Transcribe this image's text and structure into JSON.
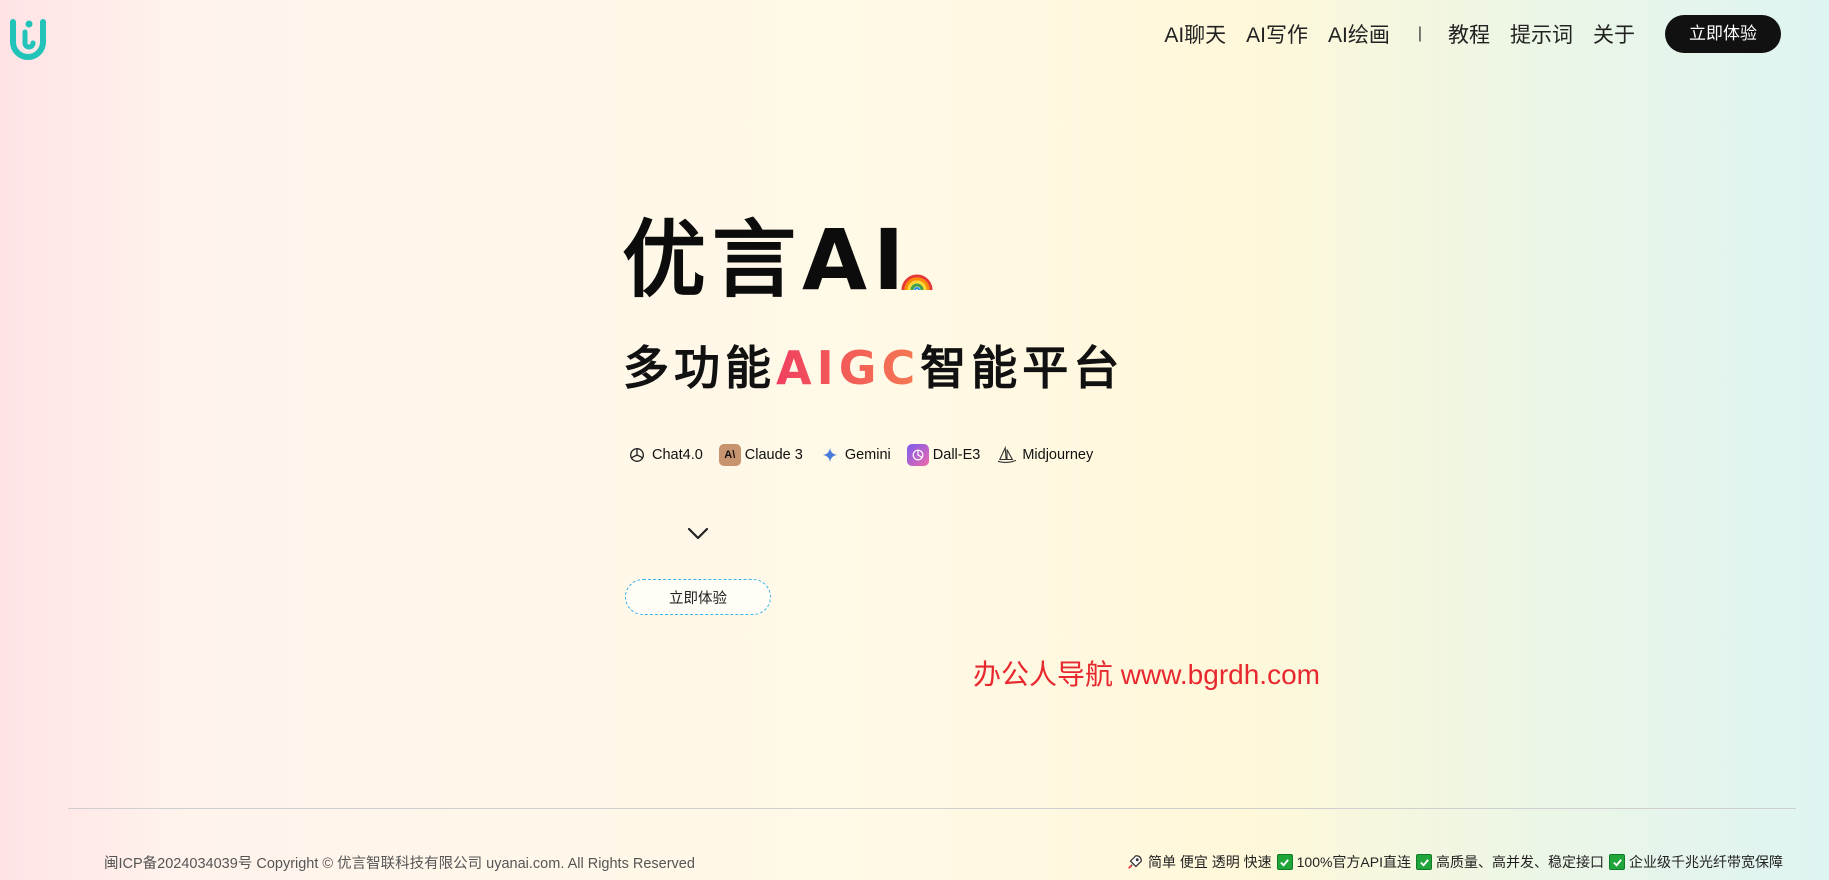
{
  "header": {
    "logo_icon": "uyan-logo-icon",
    "nav": [
      {
        "label": "AI聊天"
      },
      {
        "label": "AI写作"
      },
      {
        "label": "AI绘画"
      }
    ],
    "separator": "|",
    "nav_secondary": [
      {
        "label": "教程"
      },
      {
        "label": "提示词"
      },
      {
        "label": "关于"
      }
    ],
    "cta_label": "立即体验"
  },
  "hero": {
    "title": "优言AI",
    "subtitle_prefix": "多功能",
    "subtitle_accent": "AIGC",
    "subtitle_suffix": "智能平台",
    "models": [
      {
        "label": "Chat4.0",
        "icon": "openai-icon"
      },
      {
        "label": "Claude 3",
        "icon": "anthropic-icon"
      },
      {
        "label": "Gemini",
        "icon": "gemini-icon"
      },
      {
        "label": "Dall-E3",
        "icon": "dalle-icon"
      },
      {
        "label": "Midjourney",
        "icon": "midjourney-icon"
      }
    ],
    "cta_label": "立即体验"
  },
  "watermark": "办公人导航 www.bgrdh.com",
  "footer": {
    "copyright": "闽ICP备2024034039号 Copyright © 优言智联科技有限公司 uyanai.com. All Rights Reserved",
    "features": [
      {
        "label": "简单 便宜 透明 快速",
        "icon": "rocket-icon"
      },
      {
        "label": "100%官方API直连",
        "icon": "check-icon"
      },
      {
        "label": "高质量、高并发、稳定接口",
        "icon": "check-icon"
      },
      {
        "label": "企业级千兆光纤带宽保障",
        "icon": "check-icon"
      }
    ]
  },
  "colors": {
    "accent_gradient_start": "#f0405f",
    "accent_gradient_end": "#f57a52",
    "watermark": "#e8282f",
    "logo": "#22c3b8",
    "check": "#1fa53a"
  }
}
